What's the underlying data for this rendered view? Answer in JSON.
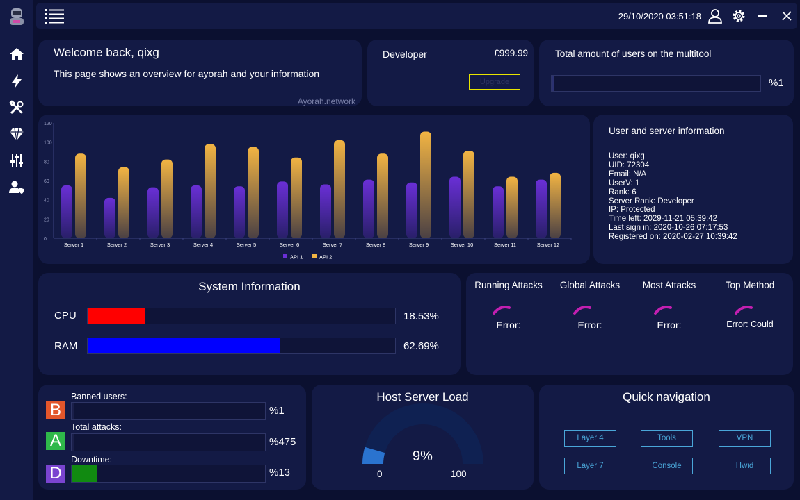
{
  "topbar": {
    "datetime": "29/10/2020 03:51:18"
  },
  "sidebar": {
    "items": [
      {
        "icon": "home-icon"
      },
      {
        "icon": "lightning-icon"
      },
      {
        "icon": "tools-icon"
      },
      {
        "icon": "diamond-icon"
      },
      {
        "icon": "sliders-icon"
      },
      {
        "icon": "user-shield-icon"
      }
    ]
  },
  "welcome": {
    "title": "Welcome back, qixg",
    "description": "This page shows an overview for ayorah and your information",
    "footer": "Ayorah.network"
  },
  "plan": {
    "name": "Developer",
    "price": "£999.99",
    "upgrade_label": "Upgrade"
  },
  "users_total": {
    "label": "Total amount of users on the multitool",
    "value": "%1",
    "fraction": 0.01
  },
  "chart_data": {
    "type": "bar",
    "categories": [
      "Server 1",
      "Server 2",
      "Server 3",
      "Server 4",
      "Server 5",
      "Server 6",
      "Server 7",
      "Server 8",
      "Server 9",
      "Server 10",
      "Server 11",
      "Server 12"
    ],
    "series": [
      {
        "name": "API 1",
        "values": [
          55,
          42,
          53,
          55,
          54,
          59,
          56,
          61,
          58,
          64,
          54,
          61
        ],
        "color": "#6a2fd6"
      },
      {
        "name": "API 2",
        "values": [
          88,
          74,
          82,
          98,
          95,
          84,
          102,
          88,
          111,
          91,
          64,
          68
        ],
        "color": "#f2b443"
      }
    ],
    "ylim": [
      0,
      120
    ],
    "yticks": [
      "0",
      "20",
      "40",
      "60",
      "80",
      "100",
      "120"
    ],
    "grid": false,
    "legend": "bottom"
  },
  "user_info": {
    "title": "User and server information",
    "lines": [
      "User: qixg",
      "UID: 72304",
      "Email: N/A",
      "UserV: 1",
      "Rank: 6",
      "Server Rank: Developer",
      "IP: Protected",
      "Time left: 2029-11-21 05:39:42",
      "Last sign in: 2020-10-26 07:17:53",
      "Registered on: 2020-02-27 10:39:42"
    ]
  },
  "system_info": {
    "title": "System Information",
    "cpu": {
      "label": "CPU",
      "value": "18.53%",
      "fraction": 0.1853,
      "color": "#ff0000"
    },
    "ram": {
      "label": "RAM",
      "value": "62.69%",
      "fraction": 0.6269,
      "color": "#0000ff"
    }
  },
  "attacks": [
    {
      "title": "Running Attacks",
      "status": "Error:"
    },
    {
      "title": "Global Attacks",
      "status": "Error:"
    },
    {
      "title": "Most Attacks",
      "status": "Error:"
    },
    {
      "title": "Top Method",
      "status": "Error: Could"
    }
  ],
  "stats": [
    {
      "letter": "B",
      "label": "Banned users:",
      "value": "%1",
      "fraction": 0.01,
      "box_color": "#e2562b",
      "fill_color": "#1a1f4a"
    },
    {
      "letter": "A",
      "label": "Total attacks:",
      "value": "%475",
      "fraction": 0.01,
      "box_color": "#2fb84a",
      "fill_color": "#1a1f4a"
    },
    {
      "letter": "D",
      "label": "Downtime:",
      "value": "%13",
      "fraction": 0.13,
      "box_color": "#7a44d0",
      "fill_color": "#118a11"
    }
  ],
  "host_load": {
    "title": "Host Server Load",
    "value": "9%",
    "fraction": 0.09,
    "min": "0",
    "max": "100"
  },
  "quick_nav": {
    "title": "Quick navigation",
    "buttons": [
      "Layer 4",
      "Tools",
      "VPN",
      "Layer 7",
      "Console",
      "Hwid"
    ]
  }
}
